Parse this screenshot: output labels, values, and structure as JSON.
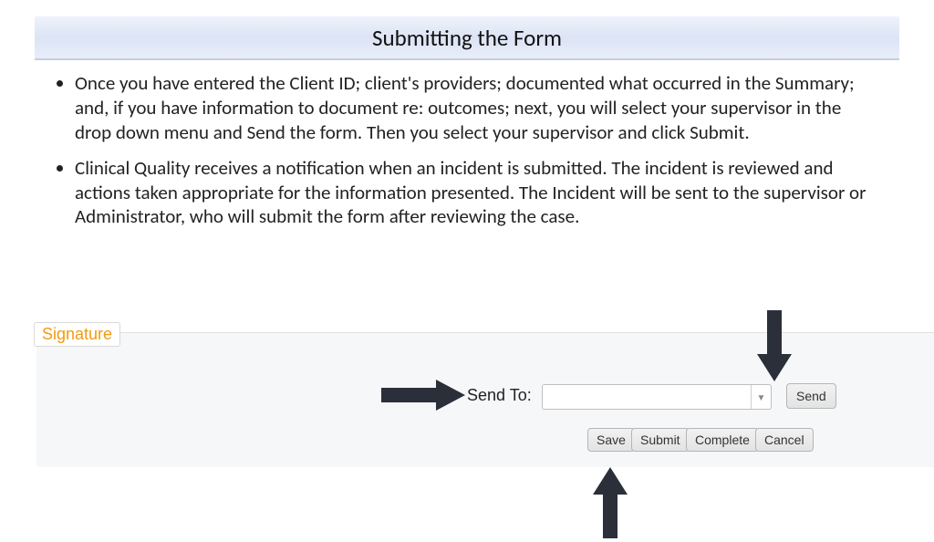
{
  "title": "Submitting the Form",
  "bullets": [
    "Once you have entered the Client ID; client's providers; documented what occurred in the Summary; and, if you have information to document re: outcomes; next, you will select your supervisor in the drop down menu and Send the form. Then you select your supervisor and click Submit.",
    "Clinical Quality receives a notification when an incident is submitted. The incident is reviewed and actions taken appropriate for the information presented. The Incident will be sent to the supervisor or Administrator, who will submit the form after reviewing the case."
  ],
  "panel": {
    "section_label": "Signature",
    "send_to_label": "Send To:",
    "dropdown_value": "",
    "buttons": {
      "send": "Send",
      "save": "Save",
      "submit": "Submit",
      "complete": "Complete",
      "cancel": "Cancel"
    }
  }
}
